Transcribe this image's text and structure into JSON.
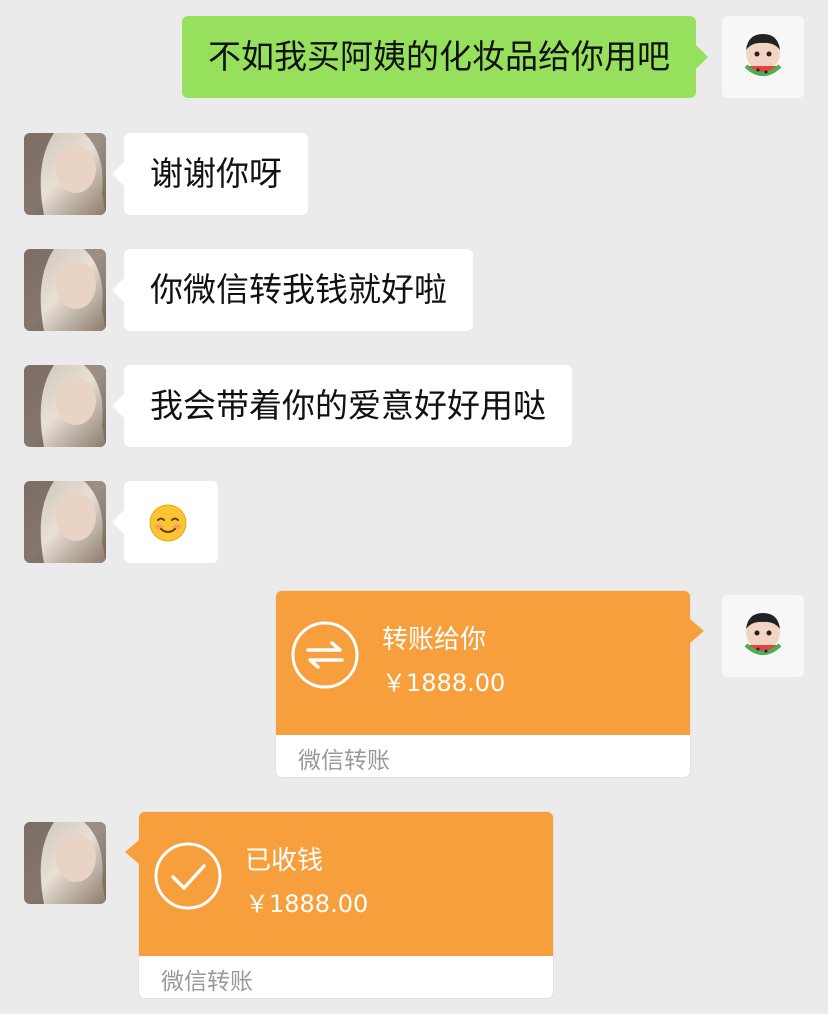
{
  "messages": [
    {
      "side": "right",
      "text": "不如我买阿姨的化妆品给你用吧"
    },
    {
      "side": "left",
      "text": "谢谢你呀"
    },
    {
      "side": "left",
      "text": "你微信转我钱就好啦"
    },
    {
      "side": "left",
      "text": "我会带着你的爱意好好用哒"
    },
    {
      "side": "left",
      "emoji": "smiling-face-emoji"
    }
  ],
  "transfer_sent": {
    "title": "转账给你",
    "amount": "￥1888.00",
    "footer": "微信转账",
    "icon": "transfer-arrows-icon"
  },
  "transfer_received": {
    "title": "已收钱",
    "amount": "￥1888.00",
    "footer": "微信转账",
    "icon": "checkmark-circle-icon"
  },
  "colors": {
    "background": "#ebebeb",
    "sent_bubble": "#96e05e",
    "received_bubble": "#ffffff",
    "transfer_orange": "#f79e3d"
  }
}
